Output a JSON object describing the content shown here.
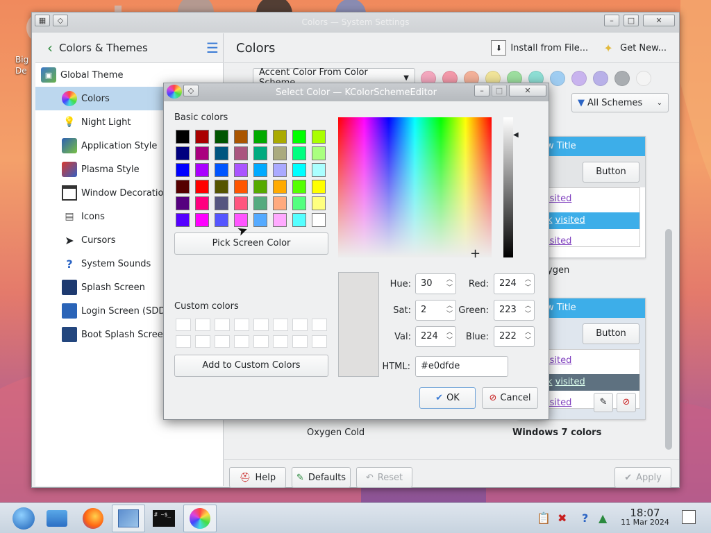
{
  "desktop": {
    "label_line1": "Big",
    "label_line2": "De"
  },
  "window": {
    "title": "Colors — System Settings",
    "sidebar": {
      "back_label": "Colors & Themes",
      "global_theme": "Global Theme",
      "items": [
        {
          "label": "Colors",
          "icon": "color-wheel-icon"
        },
        {
          "label": "Night Light",
          "icon": "light-bulb-icon"
        },
        {
          "label": "Application Style",
          "icon": "application-style-icon"
        },
        {
          "label": "Plasma Style",
          "icon": "plasma-style-icon"
        },
        {
          "label": "Window Decorations",
          "icon": "window-decorations-icon"
        },
        {
          "label": "Icons",
          "icon": "icons-icon"
        },
        {
          "label": "Cursors",
          "icon": "cursor-icon"
        },
        {
          "label": "System Sounds",
          "icon": "help-icon"
        },
        {
          "label": "Splash Screen",
          "icon": "splash-screen-icon"
        },
        {
          "label": "Login Screen (SDDM)",
          "icon": "login-screen-icon"
        },
        {
          "label": "Boot Splash Screen",
          "icon": "boot-splash-icon"
        }
      ]
    },
    "header": {
      "title": "Colors",
      "install_label": "Install from File...",
      "get_new_label": "Get New..."
    },
    "accent": {
      "combo_label": "Accent Color From Color Scheme",
      "dots": [
        "#f5a8bf",
        "#f59aab",
        "#f5b29a",
        "#f2e59a",
        "#9ee0a0",
        "#8fe0d6",
        "#9fcdf2",
        "#c8b3ee",
        "#b8b0e8",
        "#a9adb1"
      ]
    },
    "filter": {
      "label": "All Schemes"
    },
    "schemes": {
      "card1": {
        "window_title": "w Title",
        "button": "Button",
        "visited_text": "isited",
        "link_text": "k",
        "visited2": "visited",
        "visited3": "isited",
        "name": "ygen"
      },
      "card2": {
        "window_title": "w Title",
        "button": "Button",
        "visited_text": "isited",
        "link_text": "k",
        "visited2": "visited",
        "visited3": "isited"
      },
      "names": {
        "left": "Oxygen Cold",
        "right": "Windows 7 colors"
      }
    },
    "bottom": {
      "help": "Help",
      "defaults": "Defaults",
      "reset": "Reset",
      "apply": "Apply"
    }
  },
  "dialog": {
    "title": "Select Color — KColorSchemeEditor",
    "basic_colors_label": "Basic colors",
    "basic_colors": [
      [
        "#000000",
        "#aa0000",
        "#005500",
        "#aa5500",
        "#00aa00",
        "#aaaa00",
        "#00ff00",
        "#aaff00"
      ],
      [
        "#00007f",
        "#aa007f",
        "#00557f",
        "#aa557f",
        "#00aa7f",
        "#aaaa7f",
        "#00ff7f",
        "#aaff7f"
      ],
      [
        "#0000ff",
        "#aa00ff",
        "#0055ff",
        "#aa55ff",
        "#00aaff",
        "#aaaaff",
        "#00ffff",
        "#aaffff"
      ],
      [
        "#550000",
        "#ff0000",
        "#555500",
        "#ff5500",
        "#55aa00",
        "#ffaa00",
        "#55ff00",
        "#ffff00"
      ],
      [
        "#55007f",
        "#ff007f",
        "#55557f",
        "#ff557f",
        "#55aa7f",
        "#ffaa7f",
        "#55ff7f",
        "#ffff7f"
      ],
      [
        "#5500ff",
        "#ff00ff",
        "#5555ff",
        "#ff55ff",
        "#55aaff",
        "#ffaaff",
        "#55ffff",
        "#ffffff"
      ]
    ],
    "pick_screen_label": "Pick Screen Color",
    "custom_colors_label": "Custom colors",
    "add_custom_label": "Add to Custom Colors",
    "fields": {
      "hue_label": "Hue:",
      "hue": "30",
      "sat_label": "Sat:",
      "sat": "2",
      "val_label": "Val:",
      "val": "224",
      "red_label": "Red:",
      "red": "224",
      "green_label": "Green:",
      "green": "223",
      "blue_label": "Blue:",
      "blue": "222",
      "html_label": "HTML:",
      "html": "#e0dfde"
    },
    "ok_label": "OK",
    "cancel_label": "Cancel"
  },
  "taskbar": {
    "time": "18:07",
    "date": "11 Mar 2024",
    "terminal_text": "# ~$_"
  }
}
